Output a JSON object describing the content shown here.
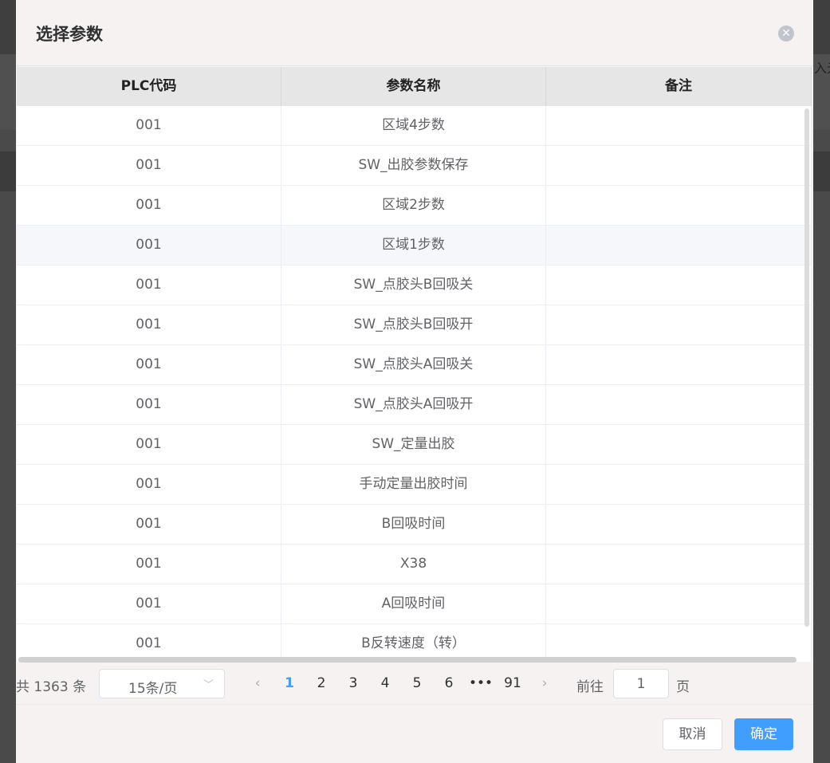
{
  "dialog": {
    "title": "选择参数",
    "close_icon": "close-circle-icon"
  },
  "background": {
    "partial_text": "入元"
  },
  "table": {
    "columns": [
      "PLC代码",
      "参数名称",
      "备注"
    ],
    "rows": [
      {
        "code": "001",
        "name": "区域4步数",
        "note": ""
      },
      {
        "code": "001",
        "name": "SW_出胶参数保存",
        "note": ""
      },
      {
        "code": "001",
        "name": "区域2步数",
        "note": ""
      },
      {
        "code": "001",
        "name": "区域1步数",
        "note": ""
      },
      {
        "code": "001",
        "name": "SW_点胶头B回吸关",
        "note": ""
      },
      {
        "code": "001",
        "name": "SW_点胶头B回吸开",
        "note": ""
      },
      {
        "code": "001",
        "name": "SW_点胶头A回吸关",
        "note": ""
      },
      {
        "code": "001",
        "name": "SW_点胶头A回吸开",
        "note": ""
      },
      {
        "code": "001",
        "name": "SW_定量出胶",
        "note": ""
      },
      {
        "code": "001",
        "name": "手动定量出胶时间",
        "note": ""
      },
      {
        "code": "001",
        "name": "B回吸时间",
        "note": ""
      },
      {
        "code": "001",
        "name": "X38",
        "note": ""
      },
      {
        "code": "001",
        "name": "A回吸时间",
        "note": ""
      },
      {
        "code": "001",
        "name": "B反转速度（转）",
        "note": ""
      }
    ],
    "hovered_row_index": 3
  },
  "pagination": {
    "total_text": "共 1363 条",
    "page_size": "15条/页",
    "prev_icon": "chevron-left-icon",
    "next_icon": "chevron-right-icon",
    "pages": [
      "1",
      "2",
      "3",
      "4",
      "5",
      "6",
      "•••",
      "91"
    ],
    "current_page": "1",
    "goto_label": "前往",
    "goto_value": "1",
    "goto_suffix": "页"
  },
  "footer": {
    "cancel_label": "取消",
    "confirm_label": "确定"
  },
  "colors": {
    "accent": "#409eff",
    "header_bg": "#e6e6e6",
    "dialog_bg": "#f5f2f1",
    "overlay": "#4a4a4a"
  }
}
